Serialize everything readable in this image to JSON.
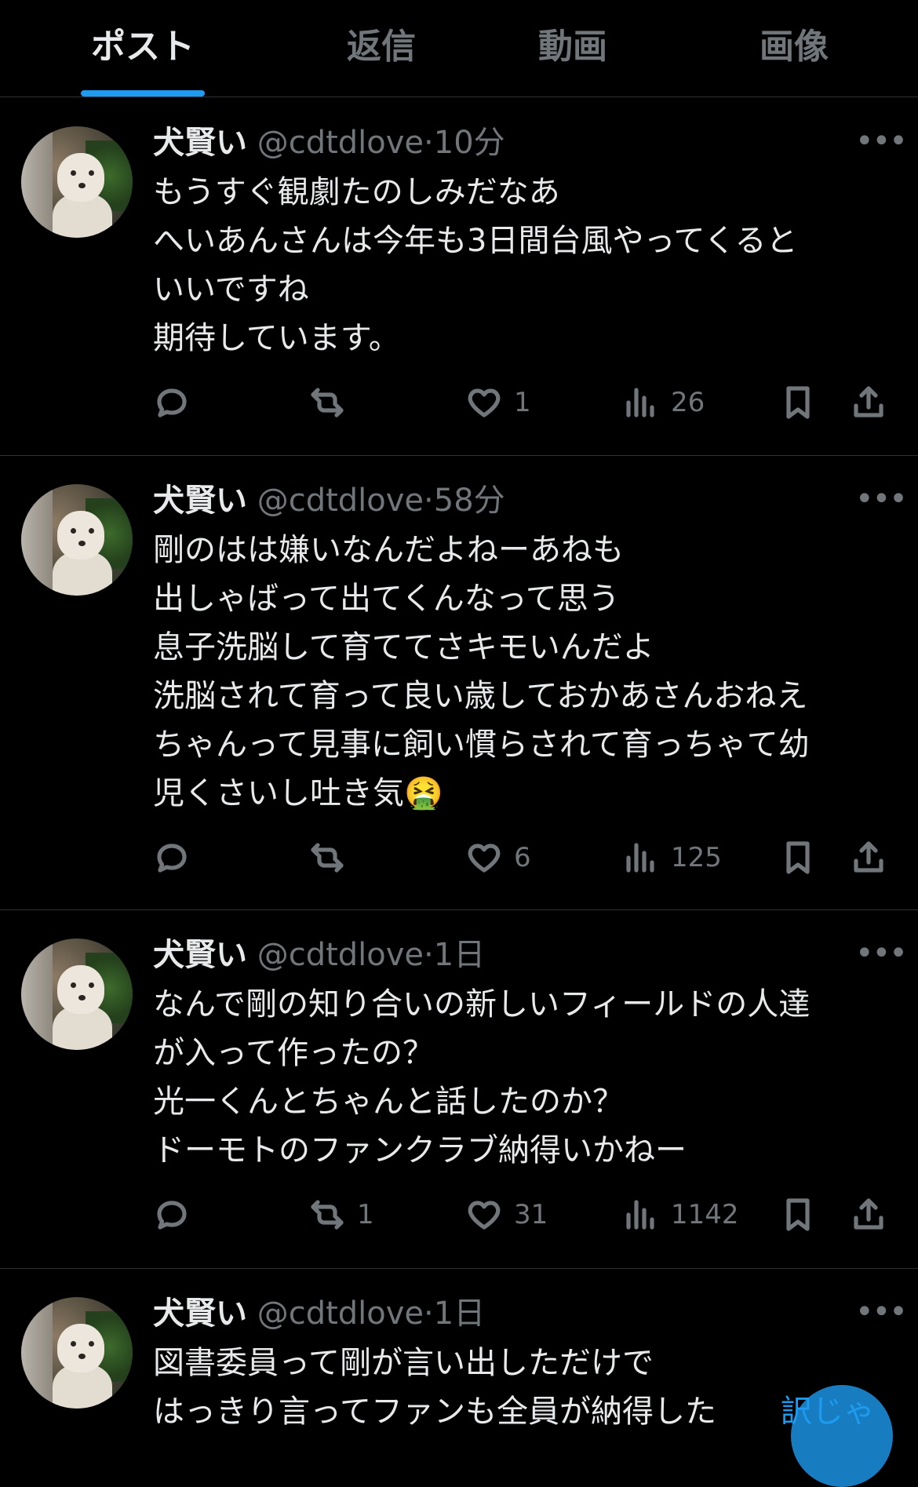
{
  "tabs": [
    {
      "label": "ポスト",
      "active": true
    },
    {
      "label": "返信",
      "active": false
    },
    {
      "label": "動画",
      "active": false
    },
    {
      "label": "画像",
      "active": false
    }
  ],
  "posts": [
    {
      "name": "犬賢い",
      "handle": "@cdtdlove",
      "dot": "·",
      "time": "10分",
      "text": "もうすぐ観劇たのしみだなあ\nへいあんさんは今年も3日間台風やってくると\nいいですね\n期待しています。",
      "reply_count": "",
      "retweet_count": "",
      "like_count": "1",
      "view_count": "26"
    },
    {
      "name": "犬賢い",
      "handle": "@cdtdlove",
      "dot": "·",
      "time": "58分",
      "text": "剛のはは嫌いなんだよねーあねも\n出しゃばって出てくんなって思う\n息子洗脳して育ててさキモいんだよ\n洗脳されて育って良い歳しておかあさんおねえ\nちゃんって見事に飼い慣らされて育っちゃて幼\n児くさいし吐き気🤮",
      "reply_count": "",
      "retweet_count": "",
      "like_count": "6",
      "view_count": "125"
    },
    {
      "name": "犬賢い",
      "handle": "@cdtdlove",
      "dot": "·",
      "time": "1日",
      "text": "なんで剛の知り合いの新しいフィールドの人達\nが入って作ったの？\n光一くんとちゃんと話したのか？\nドーモトのファンクラブ納得いかねー",
      "reply_count": "",
      "retweet_count": "1",
      "like_count": "31",
      "view_count": "1142"
    },
    {
      "name": "犬賢い",
      "handle": "@cdtdlove",
      "dot": "·",
      "time": "1日",
      "text": "図書委員って剛が言い出しただけで\nはっきり言ってファンも全員が納得した",
      "reply_count": "",
      "retweet_count": "",
      "like_count": "",
      "view_count": ""
    }
  ],
  "overlay_text": "訳じゃ",
  "icons": {
    "more": "more-dots-icon",
    "reply": "reply-bubble-icon",
    "retweet": "retweet-icon",
    "like": "heart-icon",
    "views": "views-bar-chart-icon",
    "bookmark": "bookmark-icon",
    "share": "share-upload-icon"
  },
  "colors": {
    "background": "#000000",
    "text": "#e7e9ea",
    "muted": "#71767b",
    "accent": "#1d9bf0",
    "divider": "#2f3336"
  }
}
